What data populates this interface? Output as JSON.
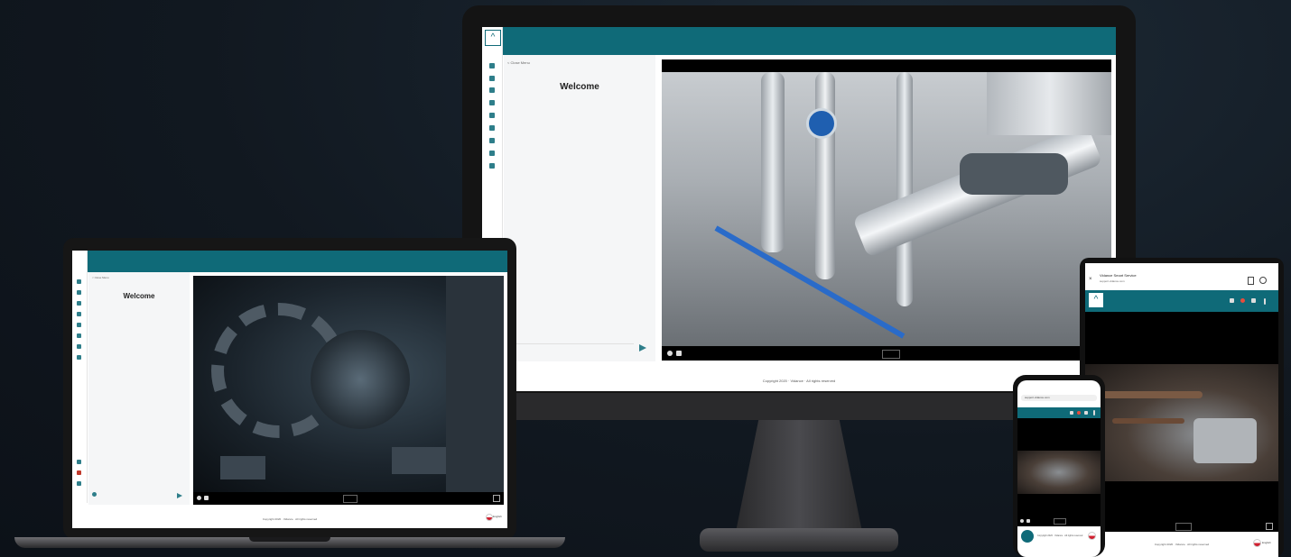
{
  "monitor": {
    "close_menu": "< Close Menu",
    "welcome": "Welcome",
    "footer": "Copyright 2020 · Vidance · All rights reserved"
  },
  "laptop": {
    "close_menu": "< Close Menu",
    "welcome": "Welcome",
    "footer": "Copyright 2020 · Vidance · All rights reserved",
    "language": "English"
  },
  "tablet": {
    "tab_title": "Vidance Smart Service",
    "url": "support.vidance.com",
    "footer": "Copyright 2020 · Vidance · All rights reserved",
    "language": "English"
  },
  "phone": {
    "url": "support.vidance.com",
    "footer": "Copyright 2020 · Vidance · All rights reserved"
  },
  "colors": {
    "brand_teal": "#0f6a78",
    "background": "#111820"
  }
}
